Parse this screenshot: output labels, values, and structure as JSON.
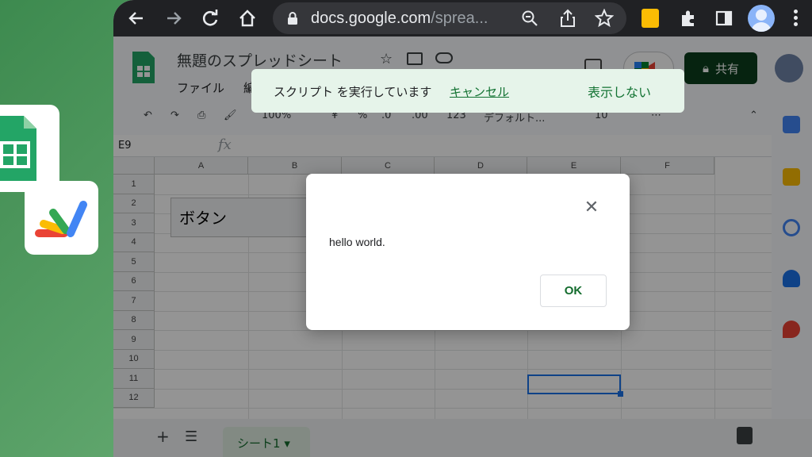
{
  "browser": {
    "url_host": "docs.google.com",
    "url_path": "/sprea...",
    "icons": [
      "back-icon",
      "forward-icon",
      "reload-icon",
      "home-icon",
      "lock-icon",
      "zoom-icon",
      "share-icon",
      "bookmark-star-icon",
      "keep-extension-icon",
      "extensions-puzzle-icon",
      "side-panel-icon",
      "profile-avatar-icon",
      "more-vert-icon"
    ]
  },
  "sheet": {
    "title": "無題のスプレッドシート",
    "menu": [
      "ファイル",
      "編"
    ],
    "share_label": "共有",
    "toolbar": {
      "zoom": "100%",
      "currency": "¥",
      "percent": "%",
      "dec_decrease": ".0",
      "dec_increase": ".00",
      "number_format": "123",
      "font": "デフォルト...",
      "font_size": "10"
    },
    "name_box": "E9",
    "fx": "fx",
    "columns": [
      "A",
      "B",
      "C",
      "D",
      "E",
      "F"
    ],
    "rows": [
      "1",
      "2",
      "3",
      "4",
      "5",
      "6",
      "7",
      "8",
      "9",
      "10",
      "11",
      "12"
    ],
    "button_drawing_label": "ボタン",
    "sheet_tab": "シート1"
  },
  "snackbar": {
    "message": "スクリプト を実行しています",
    "cancel": "キャンセル",
    "dismiss": "表示しない"
  },
  "dialog": {
    "message": "hello world.",
    "ok": "OK"
  },
  "colors": {
    "accent_green": "#146c2e",
    "share_bg": "#0b3d1c",
    "selection_blue": "#1a73e8"
  }
}
